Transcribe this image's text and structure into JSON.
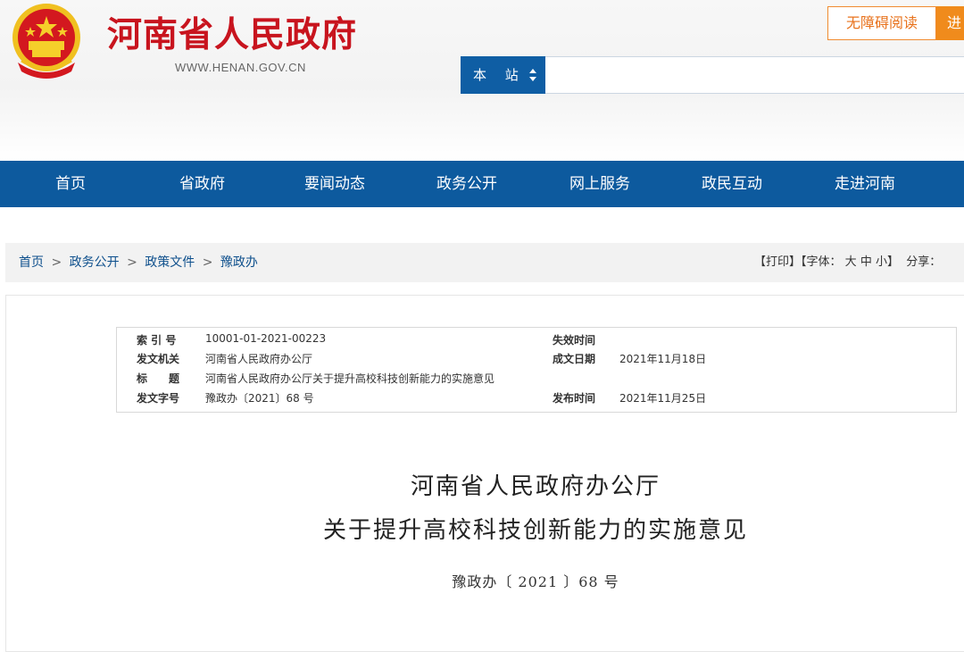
{
  "header": {
    "site_title": "河南省人民政府",
    "site_url": "WWW.HENAN.GOV.CN",
    "accessibility_label": "无障碍阅读",
    "enter_label": "进",
    "search_scope": "本 站",
    "search_value": ""
  },
  "nav": {
    "items": [
      {
        "label": "首页"
      },
      {
        "label": "省政府"
      },
      {
        "label": "要闻动态"
      },
      {
        "label": "政务公开"
      },
      {
        "label": "网上服务"
      },
      {
        "label": "政民互动"
      },
      {
        "label": "走进河南"
      }
    ]
  },
  "breadcrumb": {
    "items": [
      "首页",
      "政务公开",
      "政策文件",
      "豫政办"
    ],
    "separator": ">"
  },
  "tools": {
    "print": "【打印】",
    "font_prefix": "【字体：",
    "font_large": "大",
    "font_medium": "中",
    "font_small": "小",
    "font_suffix": "】",
    "share": "分享："
  },
  "meta": {
    "index_label": "索 引 号",
    "index_value": "10001-01-2021-00223",
    "expire_label": "失效时间",
    "expire_value": "",
    "issuer_label": "发文机关",
    "issuer_value": "河南省人民政府办公厅",
    "date_label": "成文日期",
    "date_value": "2021年11月18日",
    "title_label": "标　　题",
    "title_value": "河南省人民政府办公厅关于提升高校科技创新能力的实施意见",
    "docno_label": "发文字号",
    "docno_value": "豫政办〔2021〕68 号",
    "publish_label": "发布时间",
    "publish_value": "2021年11月25日"
  },
  "document": {
    "title_line1": "河南省人民政府办公厅",
    "title_line2": "关于提升高校科技创新能力的实施意见",
    "number": "豫政办〔 2021 〕68 号"
  },
  "colors": {
    "brand_red": "#c8141e",
    "nav_blue": "#0d5a9e",
    "accent_orange": "#f08b1c"
  },
  "icons": {
    "emblem": "national-emblem-icon",
    "scope_arrows": "sort-arrows-icon"
  }
}
